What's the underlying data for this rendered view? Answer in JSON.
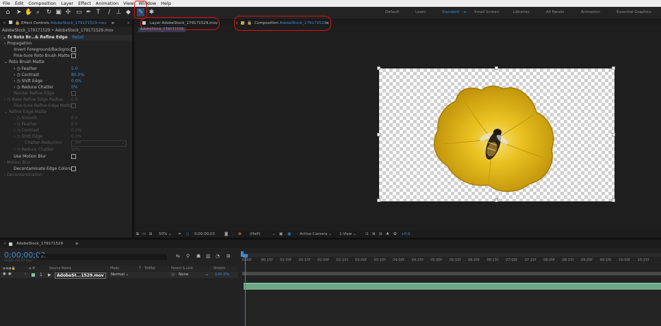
{
  "menu": [
    "File",
    "Edit",
    "Composition",
    "Layer",
    "Effect",
    "Animation",
    "View",
    "Window",
    "Help"
  ],
  "workspaces": [
    {
      "label": "Default"
    },
    {
      "label": "Learn"
    },
    {
      "label": "Standard",
      "active": true
    },
    {
      "label": "Small Screen"
    },
    {
      "label": "Libraries"
    },
    {
      "label": "All Panels"
    },
    {
      "label": "Animation"
    },
    {
      "label": "Essential Graphics"
    }
  ],
  "effect_controls": {
    "tab_prefix": "Effect Controls",
    "tab_file": "AdobeStock_179171529.mov",
    "breadcrumb": "AdobeStock_179171529 • AdobeStock_179171529.mov",
    "effect_name": "Roto Br...& Refine Edge",
    "reset_label": "Reset",
    "propagation": "Propagation",
    "invert_fg": "Invert Foreground/Backgrou",
    "fine_tune": "Fine-tune Roto Brush Matte",
    "roto_matte": "Roto Brush Matte",
    "feather": {
      "label": "Feather",
      "value": "5.0"
    },
    "contrast": {
      "label": "Contrast",
      "value": "80.0%"
    },
    "shift_edge": {
      "label": "Shift Edge",
      "value": "0.0%"
    },
    "reduce_chatter": {
      "label": "Reduce Chatter",
      "value": "0%"
    },
    "render_refine": "Render Refine Edge",
    "base_radius": {
      "label": "Base Refine Edge Radius",
      "value": "0.0"
    },
    "fine_tune_refine": "Fine-tune Refine Edge Matte",
    "refine_matte": "Refine Edge Matte",
    "r_smooth": {
      "label": "Smooth",
      "value": "0.0"
    },
    "r_feather": {
      "label": "Feather",
      "value": "0.0"
    },
    "r_contrast": {
      "label": "Contrast",
      "value": "0.0%"
    },
    "r_shift": {
      "label": "Shift Edge",
      "value": "0.0%"
    },
    "r_chatter_red": {
      "label": "Chatter Reduction",
      "value": "Off"
    },
    "r_reduce_chatter": {
      "label": "Reduce Chatter",
      "value": "50%"
    },
    "use_motion_blur": "Use Motion Blur",
    "motion_blur": "Motion Blur",
    "decontaminate": "Decontaminate Edge Colors",
    "decontamination": "Decontamination"
  },
  "viewer": {
    "layer_tab_prefix": "Layer",
    "layer_tab_file": "AdobeStock_179171529.mov",
    "comp_tab_prefix": "Composition",
    "comp_tab_file": "AdobeStock_179171529",
    "sub_tab": "AdobeStock_179171529",
    "zoom": "50%",
    "timecode": "0;00;00;03",
    "resolution": "(Half)",
    "camera": "Active Camera",
    "views": "1 View",
    "exposure": "+0.0"
  },
  "timeline": {
    "comp_name": "AdobeStock_179171529",
    "timecode": "0;00;00;03",
    "sub_timecode": "00003 (29.97 fps)",
    "search_placeholder": "ρ⌄",
    "headers": {
      "source": "Source Name",
      "mode": "Mode",
      "t": "T",
      "trkmat": "TrkMat",
      "parent": "Parent & Link",
      "stretch": "Stretch"
    },
    "layer": {
      "num": "1",
      "name": "AdobeSt...1529.mov",
      "mode": "Normal",
      "parent": "None",
      "stretch": "100.0%"
    },
    "ruler": [
      "0:00f",
      "00:15f",
      "01:00f",
      "01:15f",
      "02:00f",
      "02:15f",
      "03:00f",
      "03:15f",
      "04:00f",
      "04:15f",
      "05:00f",
      "05:15f",
      "06:00f",
      "06:15f",
      "07:00f",
      "07:15f",
      "08:00f",
      "08:15f",
      "09:00f",
      "09:15f",
      "10:00f",
      "10:15f"
    ]
  },
  "colors": {
    "accent": "#3c8ad8",
    "layer_bar": "#7ec7a0",
    "flower": "#e3b20f",
    "annotation": "#d11111"
  }
}
